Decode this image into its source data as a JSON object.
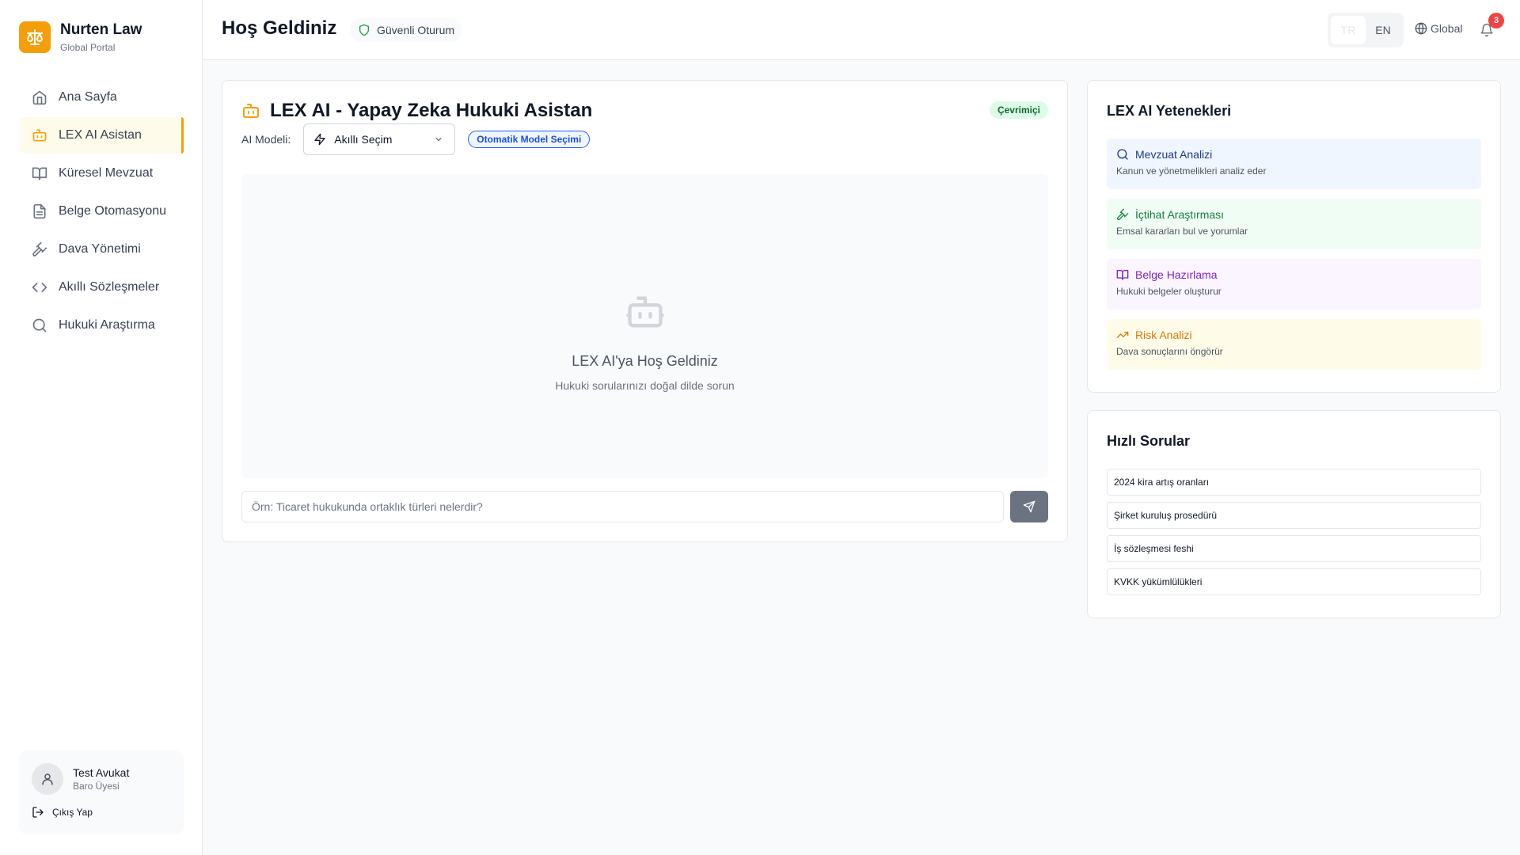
{
  "brand": {
    "name": "Nurten Law",
    "subtitle": "Global Portal"
  },
  "sidebar": {
    "items": [
      {
        "label": "Ana Sayfa",
        "icon": "home-icon"
      },
      {
        "label": "LEX AI Asistan",
        "icon": "bot-icon",
        "active": true
      },
      {
        "label": "Küresel Mevzuat",
        "icon": "book-icon"
      },
      {
        "label": "Belge Otomasyonu",
        "icon": "file-icon"
      },
      {
        "label": "Dava Yönetimi",
        "icon": "gavel-icon"
      },
      {
        "label": "Akıllı Sözleşmeler",
        "icon": "code-icon"
      },
      {
        "label": "Hukuki Araştırma",
        "icon": "search-icon"
      }
    ]
  },
  "user": {
    "name": "Test Avukat",
    "role": "Baro Üyesi",
    "logout_label": "Çıkış Yap"
  },
  "header": {
    "title": "Hoş Geldiniz",
    "secure_label": "Güvenli Oturum",
    "languages": [
      "TR",
      "EN"
    ],
    "active_language": "TR",
    "global_label": "Global",
    "notification_count": "3"
  },
  "chat": {
    "title": "LEX AI - Yapay Zeka Hukuki Asistan",
    "status": "Çevrimiçi",
    "model_label": "AI Modeli:",
    "model_value": "Akıllı Seçim",
    "auto_badge": "Otomatik Model Seçimi",
    "empty_title": "LEX AI'ya Hoş Geldiniz",
    "empty_subtitle": "Hukuki sorularınızı doğal dilde sorun",
    "input_placeholder": "Örn: Ticaret hukukunda ortaklık türleri nelerdir?"
  },
  "capabilities": {
    "title": "LEX AI Yetenekleri",
    "items": [
      {
        "title": "Mevzuat Analizi",
        "desc": "Kanun ve yönetmelikleri analiz eder",
        "icon": "search-icon",
        "color": "#1e3a8a"
      },
      {
        "title": "İçtihat Araştırması",
        "desc": "Emsal kararları bul ve yorumlar",
        "icon": "gavel-icon",
        "color": "#15803d"
      },
      {
        "title": "Belge Hazırlama",
        "desc": "Hukuki belgeler oluşturur",
        "icon": "book-icon",
        "color": "#7e22ce"
      },
      {
        "title": "Risk Analizi",
        "desc": "Dava sonuçlarını öngörür",
        "icon": "trending-up-icon",
        "color": "#d97706"
      }
    ]
  },
  "quick": {
    "title": "Hızlı Sorular",
    "items": [
      "2024 kira artış oranları",
      "Şirket kuruluş prosedürü",
      "İş sözleşmesi feshi",
      "KVKK yükümlülükleri"
    ]
  },
  "colors": {
    "accent": "#f59e0b",
    "badge_red": "#ef4444",
    "online_green": "#dcfce7"
  }
}
